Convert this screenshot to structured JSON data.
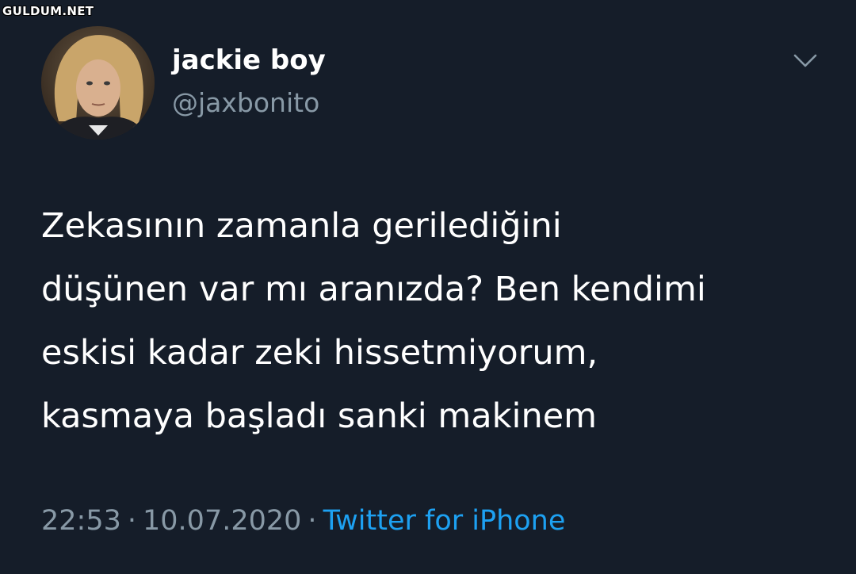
{
  "watermark": "GULDUM.NET",
  "user": {
    "display_name": "jackie boy",
    "handle": "@jaxbonito",
    "avatar_icon": "profile-photo"
  },
  "menu": {
    "icon": "chevron-down-icon"
  },
  "tweet": {
    "lines": [
      "Zekasının zamanla gerilediğini",
      "düşünen var mı aranızda? Ben kendimi",
      "eskisi kadar zeki hissetmiyorum,",
      "kasmaya başladı sanki makinem"
    ]
  },
  "meta": {
    "time": "22:53",
    "separator": "·",
    "date": "10.07.2020",
    "source": "Twitter for iPhone"
  },
  "colors": {
    "background": "#151d29",
    "text": "#ffffff",
    "secondary": "#8899a6",
    "link": "#1da1f2"
  }
}
